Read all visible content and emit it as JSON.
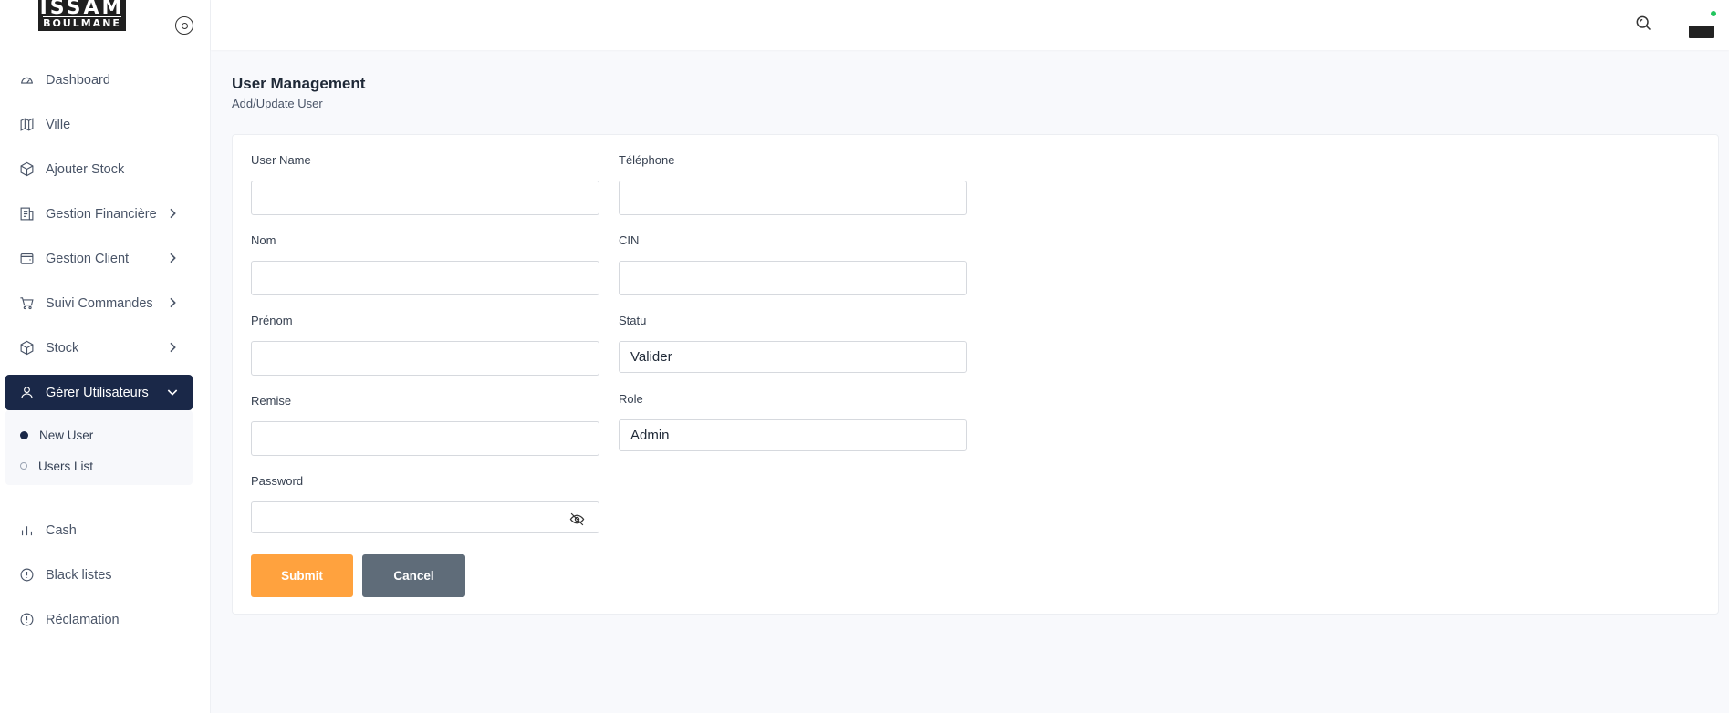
{
  "brand": {
    "logo_line1": "ISSAM",
    "logo_line2": "BOULMANE"
  },
  "sidebar": {
    "items": [
      {
        "label": "Dashboard",
        "icon": "dashboard-gauge-icon"
      },
      {
        "label": "Ville",
        "icon": "map-icon"
      },
      {
        "label": "Ajouter Stock",
        "icon": "box-icon"
      },
      {
        "label": "Gestion Financière",
        "icon": "ledger-icon",
        "expandable": true
      },
      {
        "label": "Gestion Client",
        "icon": "wallet-icon",
        "expandable": true
      },
      {
        "label": "Suivi Commandes",
        "icon": "cart-icon",
        "expandable": true
      },
      {
        "label": "Stock",
        "icon": "box-icon",
        "expandable": true
      },
      {
        "label": "Gérer Utilisateurs",
        "icon": "user-icon",
        "expandable": true,
        "active": true
      },
      {
        "label": "Cash",
        "icon": "bar-chart-icon"
      },
      {
        "label": "Black listes",
        "icon": "alert-circle-icon"
      },
      {
        "label": "Réclamation",
        "icon": "alert-circle-icon"
      }
    ],
    "submenu": [
      {
        "label": "New User",
        "selected": true
      },
      {
        "label": "Users List",
        "selected": false
      }
    ]
  },
  "header": {
    "search_icon": "search-icon",
    "status_color": "#22c55e"
  },
  "page": {
    "title": "User Management",
    "subtitle": "Add/Update User"
  },
  "form": {
    "username": {
      "label": "User Name",
      "value": ""
    },
    "telephone": {
      "label": "Téléphone",
      "value": ""
    },
    "nom": {
      "label": "Nom",
      "value": ""
    },
    "cin": {
      "label": "CIN",
      "value": ""
    },
    "prenom": {
      "label": "Prénom",
      "value": ""
    },
    "statu": {
      "label": "Statu",
      "value": "Valider"
    },
    "remise": {
      "label": "Remise",
      "value": ""
    },
    "role": {
      "label": "Role",
      "value": "Admin"
    },
    "password": {
      "label": "Password",
      "value": ""
    },
    "submit_label": "Submit",
    "cancel_label": "Cancel"
  },
  "colors": {
    "sidebar_active": "#1a2848",
    "submit": "#ffa23e",
    "cancel": "#5f6c79"
  }
}
